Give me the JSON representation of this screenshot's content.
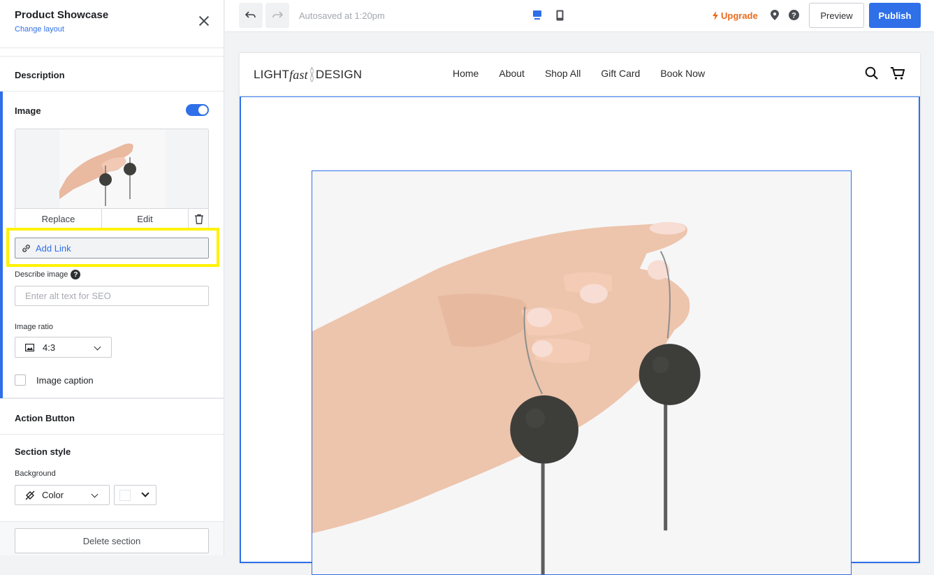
{
  "panel": {
    "title": "Product Showcase",
    "change_layout": "Change layout",
    "description_label": "Description",
    "image_label": "Image",
    "image_toggle_on": true,
    "replace_label": "Replace",
    "edit_label": "Edit",
    "add_link_label": "Add Link",
    "describe_image_label": "Describe image",
    "help_glyph": "?",
    "alt_placeholder": "Enter alt text for SEO",
    "image_ratio_label": "Image ratio",
    "image_ratio_value": "4:3",
    "image_caption_label": "Image caption",
    "action_button_label": "Action Button",
    "section_style_label": "Section style",
    "background_label": "Background",
    "background_value": "Color",
    "delete_section_label": "Delete section"
  },
  "topbar": {
    "autosave_text": "Autosaved at 1:20pm",
    "upgrade_label": "Upgrade",
    "preview_label": "Preview",
    "publish_label": "Publish"
  },
  "site": {
    "logo_light": "LIGHT",
    "logo_fast": "fast",
    "logo_design": "DESIGN",
    "nav": [
      "Home",
      "About",
      "Shop All",
      "Gift Card",
      "Book Now"
    ]
  },
  "colors": {
    "accent": "#2f6fe8",
    "upgrade": "#ec6b1c",
    "highlight": "#fff200"
  }
}
